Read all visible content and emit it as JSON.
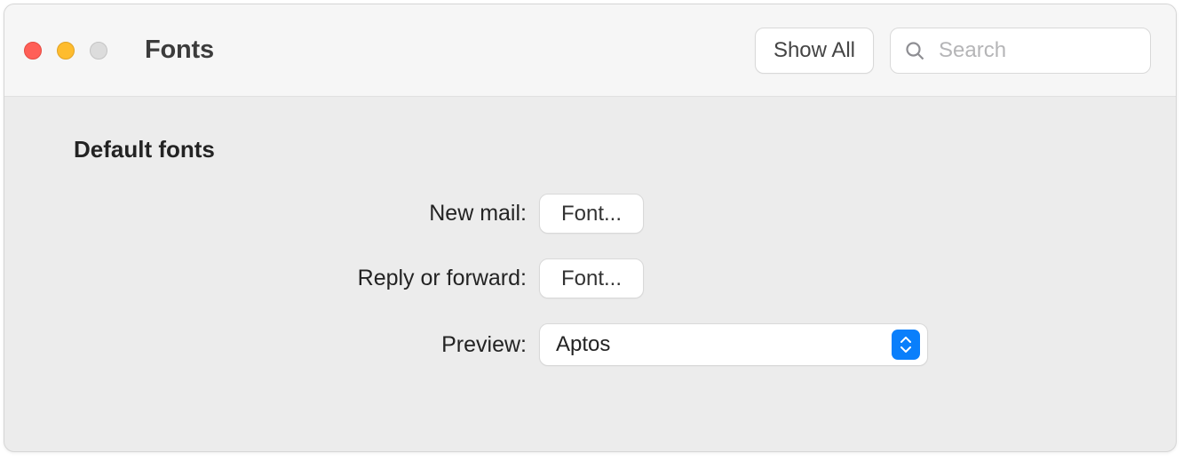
{
  "window": {
    "title": "Fonts"
  },
  "toolbar": {
    "show_all_label": "Show All",
    "search_placeholder": "Search"
  },
  "section": {
    "title": "Default fonts"
  },
  "rows": {
    "new_mail": {
      "label": "New mail:",
      "button": "Font..."
    },
    "reply_forward": {
      "label": "Reply or forward:",
      "button": "Font..."
    },
    "preview": {
      "label": "Preview:",
      "value": "Aptos"
    }
  }
}
